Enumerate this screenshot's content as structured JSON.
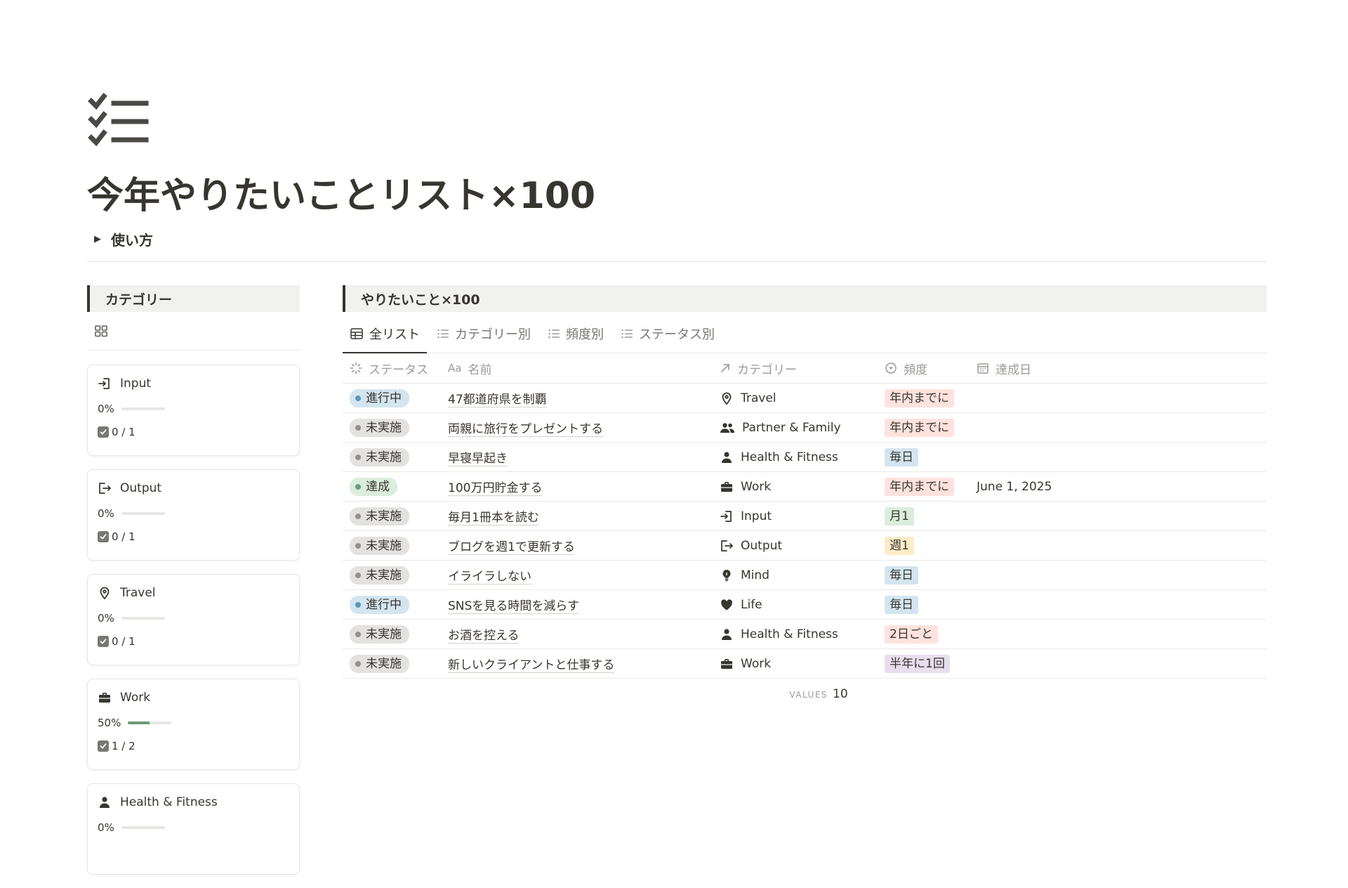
{
  "page": {
    "title": "今年やりたいことリスト×100",
    "icon": "checklist-icon"
  },
  "toggle": {
    "label": "使い方"
  },
  "categories_panel": {
    "heading": "カテゴリー",
    "cards": [
      {
        "name": "Input",
        "icon": "input-icon",
        "percent": "0%",
        "progress": 0,
        "count": "0 / 1"
      },
      {
        "name": "Output",
        "icon": "output-icon",
        "percent": "0%",
        "progress": 0,
        "count": "0 / 1"
      },
      {
        "name": "Travel",
        "icon": "location-pin-icon",
        "percent": "0%",
        "progress": 0,
        "count": "0 / 1"
      },
      {
        "name": "Work",
        "icon": "briefcase-icon",
        "percent": "50%",
        "progress": 0.5,
        "count": "1 / 2"
      },
      {
        "name": "Health & Fitness",
        "icon": "person-icon",
        "percent": "0%",
        "progress": 0
      }
    ]
  },
  "database": {
    "heading": "やりたいこと×100",
    "tabs": [
      {
        "label": "全リスト",
        "icon": "table-icon",
        "active": true
      },
      {
        "label": "カテゴリー別",
        "icon": "list-icon",
        "active": false
      },
      {
        "label": "頻度別",
        "icon": "list-icon",
        "active": false
      },
      {
        "label": "ステータス別",
        "icon": "list-icon",
        "active": false
      }
    ],
    "columns": [
      {
        "label": "ステータス",
        "icon": "status-icon"
      },
      {
        "label": "名前",
        "icon": "text-icon",
        "prefix": "Aa"
      },
      {
        "label": "カテゴリー",
        "icon": "relation-arrow-icon"
      },
      {
        "label": "頻度",
        "icon": "select-icon"
      },
      {
        "label": "達成日",
        "icon": "calendar-icon"
      }
    ],
    "rows": [
      {
        "status": "進行中",
        "name": "47都道府県を制覇",
        "category": "Travel",
        "category_icon": "location-pin-icon",
        "frequency": "年内までに",
        "date": ""
      },
      {
        "status": "未実施",
        "name": "両親に旅行をプレゼントする",
        "category": "Partner & Family",
        "category_icon": "people-icon",
        "frequency": "年内までに",
        "date": ""
      },
      {
        "status": "未実施",
        "name": "早寝早起き",
        "category": "Health & Fitness",
        "category_icon": "person-icon",
        "frequency": "毎日",
        "date": ""
      },
      {
        "status": "達成",
        "name": "100万円貯金する",
        "category": "Work",
        "category_icon": "briefcase-icon",
        "frequency": "年内までに",
        "date": "June 1, 2025"
      },
      {
        "status": "未実施",
        "name": "毎月1冊本を読む",
        "category": "Input",
        "category_icon": "input-icon",
        "frequency": "月1",
        "date": ""
      },
      {
        "status": "未実施",
        "name": "ブログを週1で更新する",
        "category": "Output",
        "category_icon": "output-icon",
        "frequency": "週1",
        "date": ""
      },
      {
        "status": "未実施",
        "name": "イライラしない",
        "category": "Mind",
        "category_icon": "lightbulb-icon",
        "frequency": "毎日",
        "date": ""
      },
      {
        "status": "進行中",
        "name": "SNSを見る時間を減らす",
        "category": "Life",
        "category_icon": "heart-icon",
        "frequency": "毎日",
        "date": ""
      },
      {
        "status": "未実施",
        "name": "お酒を控える",
        "category": "Health & Fitness",
        "category_icon": "person-icon",
        "frequency": "2日ごと",
        "date": ""
      },
      {
        "status": "未実施",
        "name": "新しいクライアントと仕事する",
        "category": "Work",
        "category_icon": "briefcase-icon",
        "frequency": "半年に1回",
        "date": ""
      }
    ],
    "footer": {
      "label": "VALUES",
      "value": "10"
    }
  },
  "colors": {
    "status": {
      "進行中": {
        "bg": "#d3e5ef",
        "dot": "#5b97bd"
      },
      "未実施": {
        "bg": "#e3e2e0",
        "dot": "#91918e"
      },
      "達成": {
        "bg": "#dbeddb",
        "dot": "#6c9b7d"
      }
    },
    "frequency": {
      "年内までに": "#ffe2dd",
      "毎日": "#d3e5ef",
      "月1": "#dbeddb",
      "週1": "#fdecc8",
      "2日ごと": "#ffe2dd",
      "半年に1回": "#e8deee"
    },
    "progress_fill": "#6c9a74"
  }
}
